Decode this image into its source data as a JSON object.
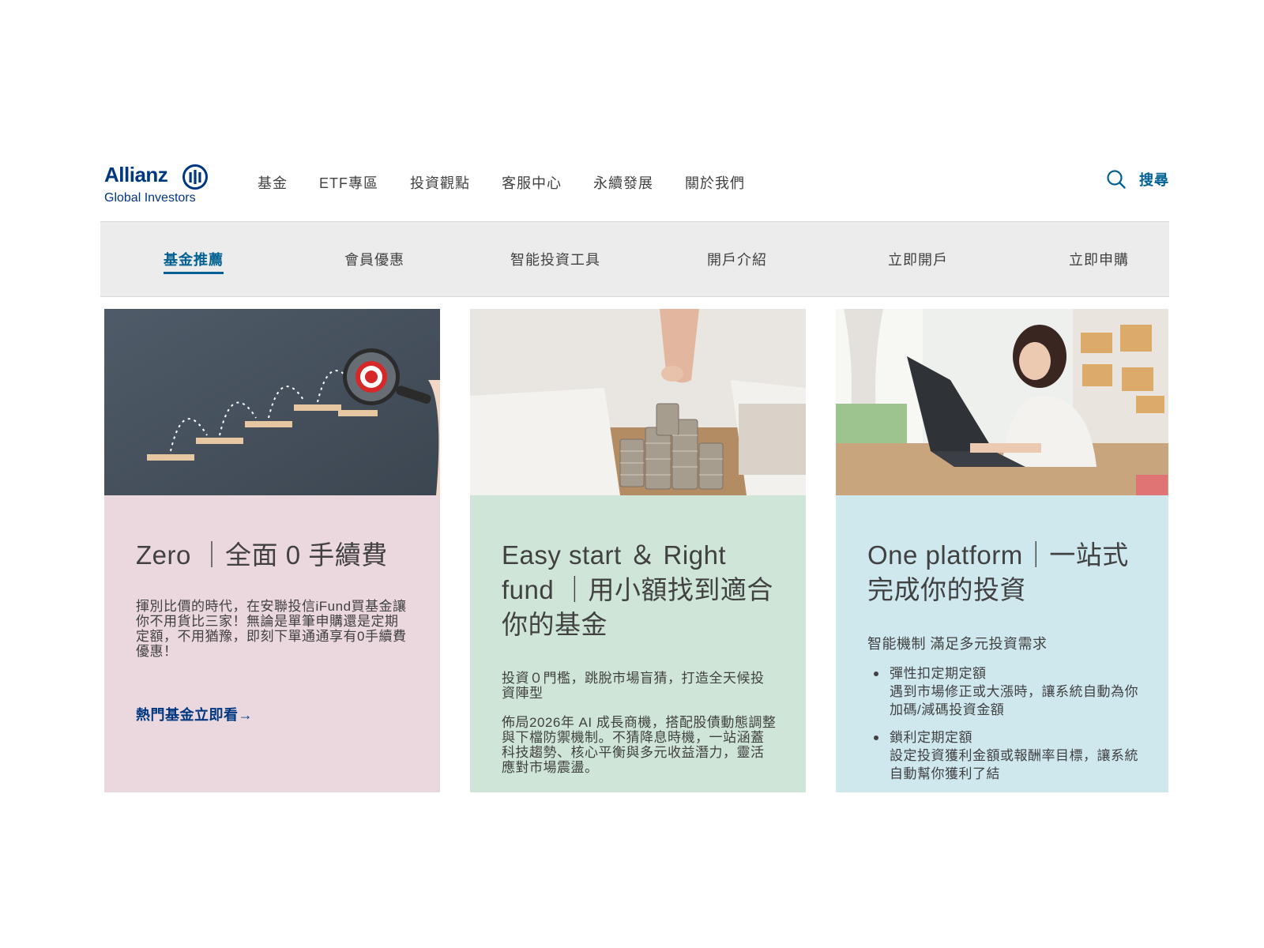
{
  "brand": {
    "name": "Allianz",
    "sub": "Global Investors",
    "color": "#003781"
  },
  "nav": {
    "items": [
      "基金",
      "ETF專區",
      "投資觀點",
      "客服中心",
      "永續發展",
      "關於我們"
    ],
    "search_label": "搜尋"
  },
  "subnav": {
    "items": [
      "基金推薦",
      "會員優惠",
      "智能投資工具",
      "開戶介紹",
      "立即開戶",
      "立即申購"
    ],
    "active_index": 0,
    "accent": "#006192"
  },
  "cards": [
    {
      "title": "Zero ｜全面 0 手續費",
      "text": "揮別比價的時代，在安聯投信iFund買基金讓你不用貨比三家！無論是單筆申購還是定期定額，不用猶豫，即刻下單通通享有0手續費優惠！",
      "link": "熱門基金立即看",
      "image": "stairs-target-image",
      "bg": "#ead8de"
    },
    {
      "title": "Easy start ＆ Right fund ｜用小額找到適合你的基金",
      "text1": "投資０門檻，跳脫市場盲猜，打造全天候投資陣型",
      "text2": "佈局2026年 AI 成長商機，搭配股債動態調整與下檔防禦機制。不猜降息時機，一站涵蓋科技趨勢、核心平衡與多元收益潛力，靈活應對市場震盪。",
      "image": "coin-stacks-image",
      "bg": "#cfe5d7"
    },
    {
      "title": "One platform｜一站式完成你的投資",
      "subtitle": "智能機制 滿足多元投資需求",
      "bullets": [
        {
          "title": "彈性扣定期定額",
          "desc": "遇到市場修正或大漲時，讓系統自動為你加碼/減碼投資金額"
        },
        {
          "title": "鎖利定期定額",
          "desc": "設定投資獲利金額或報酬率目標，讓系統自動幫你獲利了結"
        }
      ],
      "image": "woman-laptop-image",
      "bg": "#cfe8ee"
    }
  ]
}
